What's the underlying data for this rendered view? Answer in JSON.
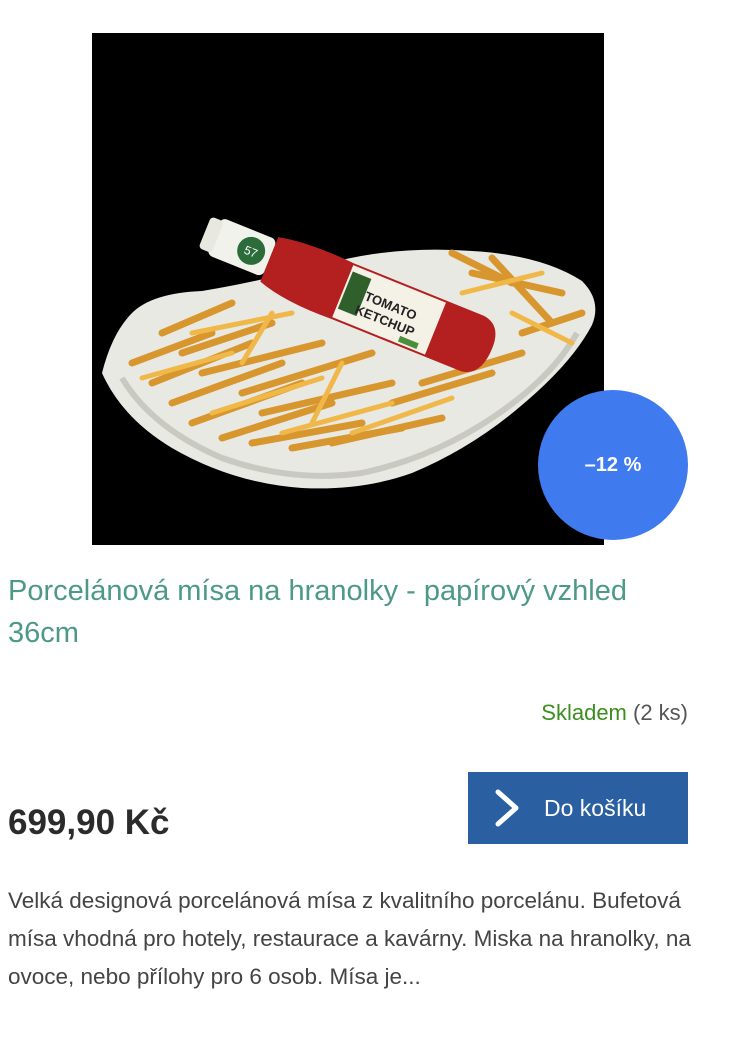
{
  "product": {
    "image": "french-fries-porcelain-bowl-with-ketchup",
    "discount": "–12 %",
    "title": "Porcelánová mísa na hranolky - papírový vzhled 36cm",
    "availability": {
      "status": "Skladem",
      "count": "(2 ks)"
    },
    "price": "699,90 Kč",
    "cart_button": {
      "label": "Do košíku",
      "icon": "chevron-right-icon"
    },
    "description": "Velká designová porcelánová mísa z kvalitního porcelánu. Bufetová mísa vhodná pro hotely, restaurace a kavárny. Miska na hranolky, na ovoce, nebo přílohy pro 6 osob. Mísa je..."
  },
  "colors": {
    "discount_badge": "#3f7bef",
    "title": "#4c9a86",
    "stock": "#3a8f1e",
    "cart_button": "#2a5fa2"
  }
}
